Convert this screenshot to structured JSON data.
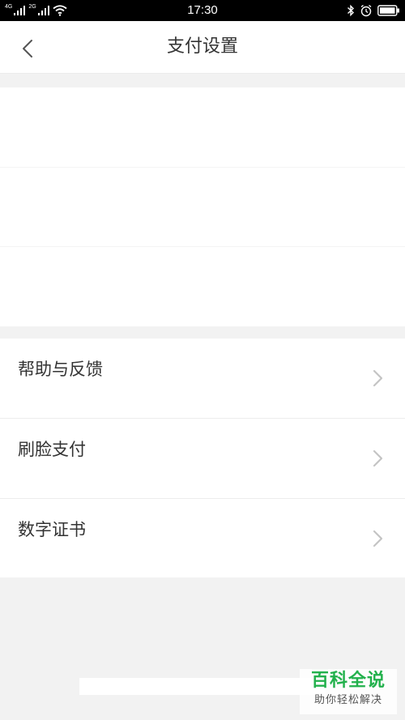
{
  "status_bar": {
    "network_1": "4G",
    "network_2": "2G",
    "time": "17:30"
  },
  "header": {
    "title": "支付设置"
  },
  "menu": {
    "items": [
      {
        "label": "帮助与反馈"
      },
      {
        "label": "刷脸支付"
      },
      {
        "label": "数字证书"
      }
    ]
  },
  "watermark": {
    "title": "百科全说",
    "subtitle": "助你轻松解决"
  },
  "colors": {
    "status_bar_bg": "#000000",
    "page_bg": "#f2f2f2",
    "card_bg": "#ffffff",
    "text_primary": "#333333",
    "chevron": "#c4c4c4",
    "watermark_green": "#22b14c"
  },
  "icons": {
    "back": "chevron-left-icon",
    "row_arrow": "chevron-right-icon",
    "signal": "signal-bars-icon",
    "wifi": "wifi-icon",
    "bluetooth": "bluetooth-icon",
    "alarm": "alarm-clock-icon",
    "battery": "battery-icon"
  }
}
